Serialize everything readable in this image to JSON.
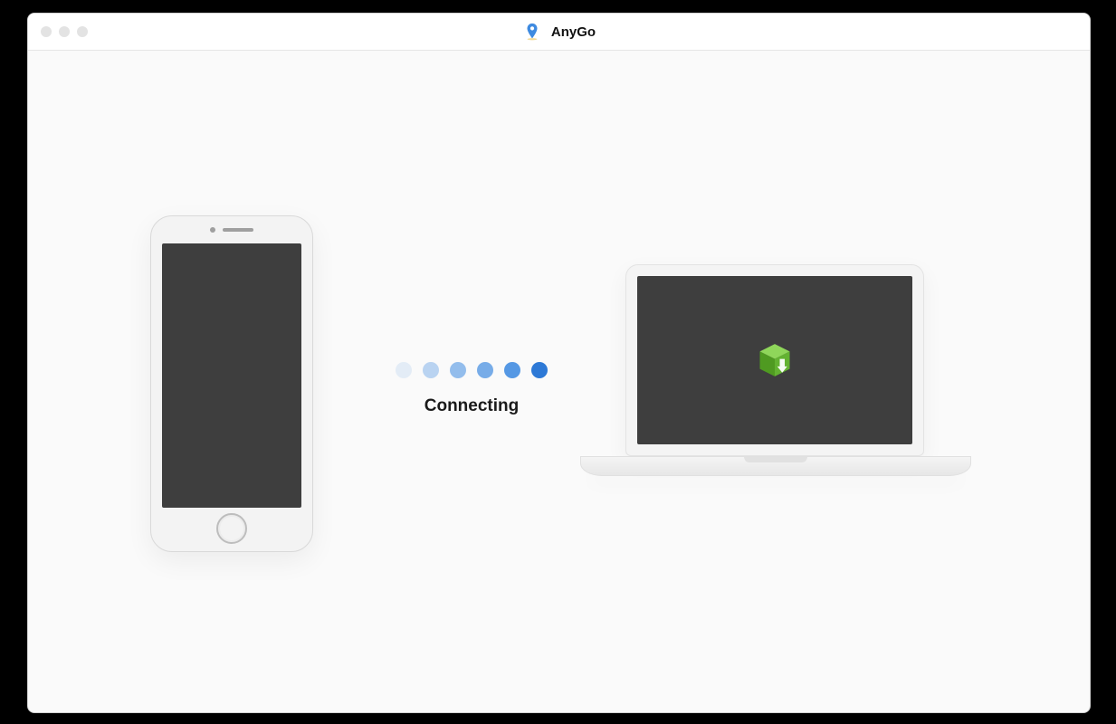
{
  "app": {
    "title": "AnyGo",
    "icon_name": "map-pin-icon"
  },
  "status": {
    "label": "Connecting",
    "dot_count": 6
  },
  "devices": {
    "phone_icon": "iphone-device-icon",
    "laptop_icon": "laptop-device-icon",
    "laptop_app_icon": "package-download-icon"
  },
  "colors": {
    "accent": "#2d79d6",
    "screen_dark": "#3e3e3e",
    "package_green": "#63b231"
  }
}
